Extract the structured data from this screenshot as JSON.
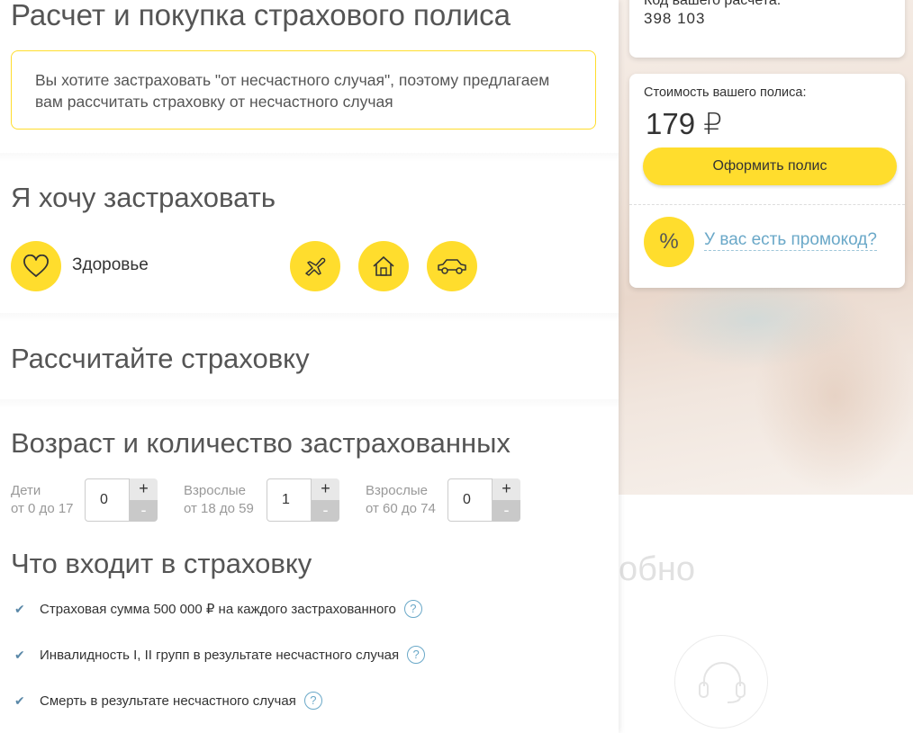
{
  "header": {
    "title": "Расчет и покупка страхового полиса"
  },
  "notice": {
    "text": "Вы хотите застраховать \"от несчастного случая\", поэтому предлагаем вам рассчитать страховку от несчастного случая"
  },
  "insure": {
    "title": "Я хочу застраховать",
    "categories": [
      {
        "label": "Здоровье",
        "icon": "heart-icon"
      },
      {
        "icon": "plane-icon"
      },
      {
        "icon": "house-icon"
      },
      {
        "icon": "car-icon"
      }
    ]
  },
  "calculate": {
    "title": "Рассчитайте страховку"
  },
  "ages": {
    "title": "Возраст и количество застрахованных",
    "groups": [
      {
        "line1": "Дети",
        "line2": "от 0 до 17",
        "value": "0"
      },
      {
        "line1": "Взрослые",
        "line2": "от 18 до 59",
        "value": "1"
      },
      {
        "line1": "Взрослые",
        "line2": "от 60 до 74",
        "value": "0"
      }
    ],
    "plus": "+",
    "minus": "-"
  },
  "coverage": {
    "title": "Что входит в страховку",
    "items": [
      "Страховая сумма 500 000 ₽ на каждого застрахованного",
      "Инвалидность I, II групп в результате несчастного случая",
      "Смерть в результате несчастного случая"
    ],
    "help_symbol": "?",
    "check_symbol": "✔"
  },
  "calc_card": {
    "label": "Код вашего расчета:",
    "code": "398 103"
  },
  "price_card": {
    "label": "Стоимость вашего полиса:",
    "price": "179 ₽",
    "button": "Оформить полис",
    "promo_symbol": "%",
    "promo_link": "У вас есть промокод?"
  },
  "background": {
    "word": "обно"
  },
  "colors": {
    "accent": "#ffdd2d",
    "link": "#6aa8c8"
  }
}
